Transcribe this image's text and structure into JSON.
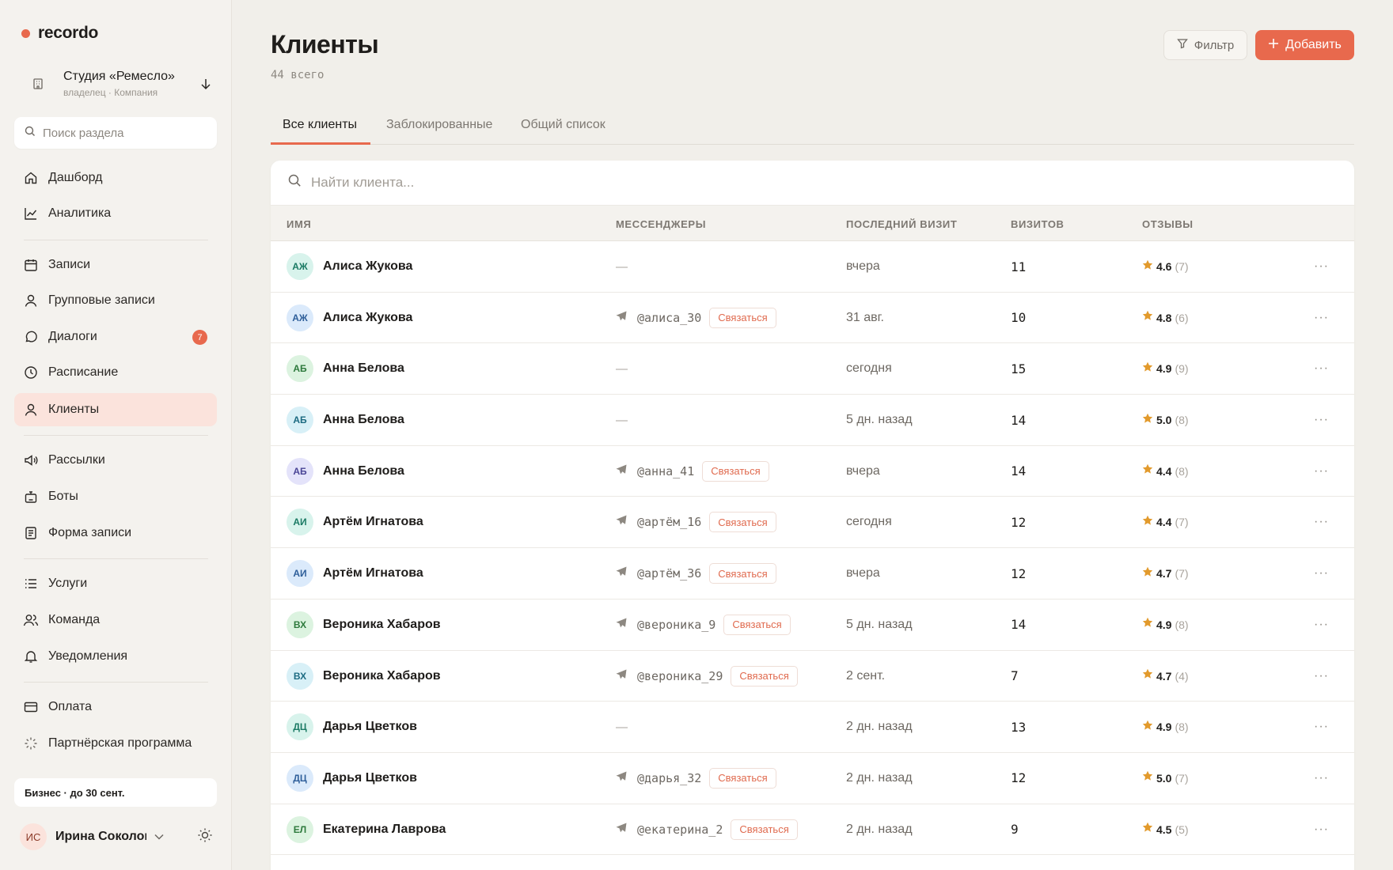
{
  "app": {
    "name": "recordo"
  },
  "org": {
    "name": "Студия «Ремесло»",
    "role": "владелец · Компания"
  },
  "sidebar": {
    "search_placeholder": "Поиск раздела",
    "items": [
      {
        "label": "Дашборд",
        "icon": "home-icon"
      },
      {
        "label": "Аналитика",
        "icon": "chart-icon"
      },
      {
        "label": "Записи",
        "icon": "calendar-icon"
      },
      {
        "label": "Групповые записи",
        "icon": "user-icon"
      },
      {
        "label": "Диалоги",
        "icon": "chat-icon",
        "badge": "7"
      },
      {
        "label": "Расписание",
        "icon": "clock-icon"
      },
      {
        "label": "Клиенты",
        "icon": "user-icon",
        "active": true
      },
      {
        "label": "Рассылки",
        "icon": "megaphone-icon"
      },
      {
        "label": "Боты",
        "icon": "bot-icon"
      },
      {
        "label": "Форма записи",
        "icon": "form-icon"
      },
      {
        "label": "Услуги",
        "icon": "list-icon"
      },
      {
        "label": "Команда",
        "icon": "team-icon"
      },
      {
        "label": "Уведомления",
        "icon": "bell-icon"
      },
      {
        "label": "Оплата",
        "icon": "card-icon"
      },
      {
        "label": "Партнёрская программа",
        "icon": "sparkle-icon"
      }
    ],
    "plan": "Бизнес · до 30 сент.",
    "user": {
      "initials": "ИС",
      "name": "Ирина Соколова"
    }
  },
  "page": {
    "title": "Клиенты",
    "subtitle": "44 всего",
    "filter_label": "Фильтр",
    "add_label": "Добавить"
  },
  "tabs": [
    {
      "label": "Все клиенты",
      "active": true
    },
    {
      "label": "Заблокированные"
    },
    {
      "label": "Общий список"
    }
  ],
  "table": {
    "search_placeholder": "Найти клиента...",
    "columns": {
      "name": "ИМЯ",
      "messengers": "МЕССЕНДЖЕРЫ",
      "last_visit": "ПОСЛЕДНИЙ ВИЗИТ",
      "visits": "ВИЗИТОВ",
      "reviews": "ОТЗЫВЫ"
    },
    "contact_label": "Связаться",
    "rows": [
      {
        "initials": "АЖ",
        "avatar_bg": "#d8f3ec",
        "avatar_fg": "#1b7a64",
        "name": "Алиса Жукова",
        "handle": "",
        "last_visit": "вчера",
        "visits": "11",
        "rating": "4.6",
        "reviews": "(7)"
      },
      {
        "initials": "АЖ",
        "avatar_bg": "#dbeafb",
        "avatar_fg": "#2f5f9a",
        "name": "Алиса Жукова",
        "handle": "@алиса_30",
        "last_visit": "31 авг.",
        "visits": "10",
        "rating": "4.8",
        "reviews": "(6)"
      },
      {
        "initials": "АБ",
        "avatar_bg": "#dcf3e0",
        "avatar_fg": "#2e7a3d",
        "name": "Анна Белова",
        "handle": "",
        "last_visit": "сегодня",
        "visits": "15",
        "rating": "4.9",
        "reviews": "(9)"
      },
      {
        "initials": "АБ",
        "avatar_bg": "#d8f0f7",
        "avatar_fg": "#1d6b82",
        "name": "Анна Белова",
        "handle": "",
        "last_visit": "5 дн. назад",
        "visits": "14",
        "rating": "5.0",
        "reviews": "(8)"
      },
      {
        "initials": "АБ",
        "avatar_bg": "#e4e3fa",
        "avatar_fg": "#4a4596",
        "name": "Анна Белова",
        "handle": "@анна_41",
        "last_visit": "вчера",
        "visits": "14",
        "rating": "4.4",
        "reviews": "(8)"
      },
      {
        "initials": "АИ",
        "avatar_bg": "#d8f3ec",
        "avatar_fg": "#1b7a64",
        "name": "Артём Игнатова",
        "handle": "@артём_16",
        "last_visit": "сегодня",
        "visits": "12",
        "rating": "4.4",
        "reviews": "(7)"
      },
      {
        "initials": "АИ",
        "avatar_bg": "#dbeafb",
        "avatar_fg": "#2f5f9a",
        "name": "Артём Игнатова",
        "handle": "@артём_36",
        "last_visit": "вчера",
        "visits": "12",
        "rating": "4.7",
        "reviews": "(7)"
      },
      {
        "initials": "ВХ",
        "avatar_bg": "#dcf3e0",
        "avatar_fg": "#2e7a3d",
        "name": "Вероника Хабаров",
        "handle": "@вероника_9",
        "last_visit": "5 дн. назад",
        "visits": "14",
        "rating": "4.9",
        "reviews": "(8)"
      },
      {
        "initials": "ВХ",
        "avatar_bg": "#d8f0f7",
        "avatar_fg": "#1d6b82",
        "name": "Вероника Хабаров",
        "handle": "@вероника_29",
        "last_visit": "2 сент.",
        "visits": "7",
        "rating": "4.7",
        "reviews": "(4)"
      },
      {
        "initials": "ДЦ",
        "avatar_bg": "#d8f3ec",
        "avatar_fg": "#1b7a64",
        "name": "Дарья Цветков",
        "handle": "",
        "last_visit": "2 дн. назад",
        "visits": "13",
        "rating": "4.9",
        "reviews": "(8)"
      },
      {
        "initials": "ДЦ",
        "avatar_bg": "#dbeafb",
        "avatar_fg": "#2f5f9a",
        "name": "Дарья Цветков",
        "handle": "@дарья_32",
        "last_visit": "2 дн. назад",
        "visits": "12",
        "rating": "5.0",
        "reviews": "(7)"
      },
      {
        "initials": "ЕЛ",
        "avatar_bg": "#dcf3e0",
        "avatar_fg": "#2e7a3d",
        "name": "Екатерина Лаврова",
        "handle": "@екатерина_2",
        "last_visit": "2 дн. назад",
        "visits": "9",
        "rating": "4.5",
        "reviews": "(5)"
      }
    ]
  },
  "colors": {
    "accent": "#e8694d",
    "star": "#e29a2c",
    "active_bg": "#fbe3dc"
  }
}
